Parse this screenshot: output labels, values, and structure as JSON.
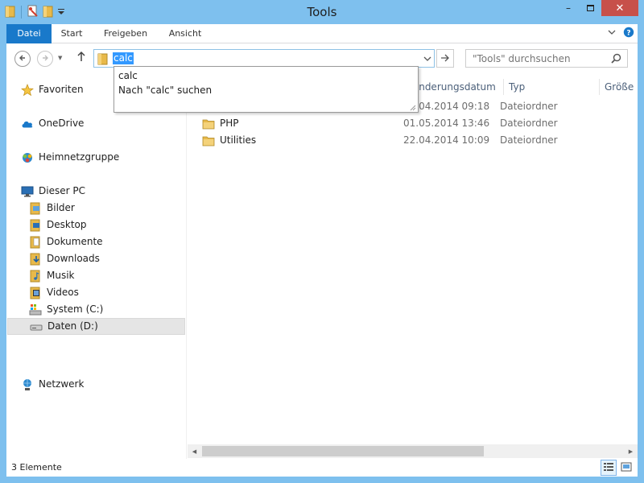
{
  "window": {
    "title": "Tools",
    "minimize_label": "–",
    "close_label": "✕"
  },
  "ribbon": {
    "tabs": [
      "Datei",
      "Start",
      "Freigeben",
      "Ansicht"
    ]
  },
  "address": {
    "value": "calc",
    "search_placeholder": "\"Tools\" durchsuchen"
  },
  "autocomplete": {
    "items": [
      "calc",
      "Nach \"calc\" suchen"
    ]
  },
  "nav": {
    "favorites": "Favoriten",
    "onedrive": "OneDrive",
    "homegroup": "Heimnetzgruppe",
    "thispc": "Dieser PC",
    "pc_items": [
      "Bilder",
      "Desktop",
      "Dokumente",
      "Downloads",
      "Musik",
      "Videos",
      "System (C:)",
      "Daten (D:)"
    ],
    "network": "Netzwerk"
  },
  "columns": {
    "date": "Änderungsdatum",
    "type": "Typ",
    "size": "Größe"
  },
  "files": [
    {
      "name": "",
      "date": "30.04.2014 09:18",
      "type": "Dateiordner"
    },
    {
      "name": "PHP",
      "date": "01.05.2014 13:46",
      "type": "Dateiordner"
    },
    {
      "name": "Utilities",
      "date": "22.04.2014 10:09",
      "type": "Dateiordner"
    }
  ],
  "status": {
    "count": "3 Elemente"
  },
  "colors": {
    "frame": "#7ec0ee",
    "file_tab": "#1979ca",
    "close_button": "#c7504a",
    "selection": "#3399ff",
    "folder": "#e8b94a"
  }
}
